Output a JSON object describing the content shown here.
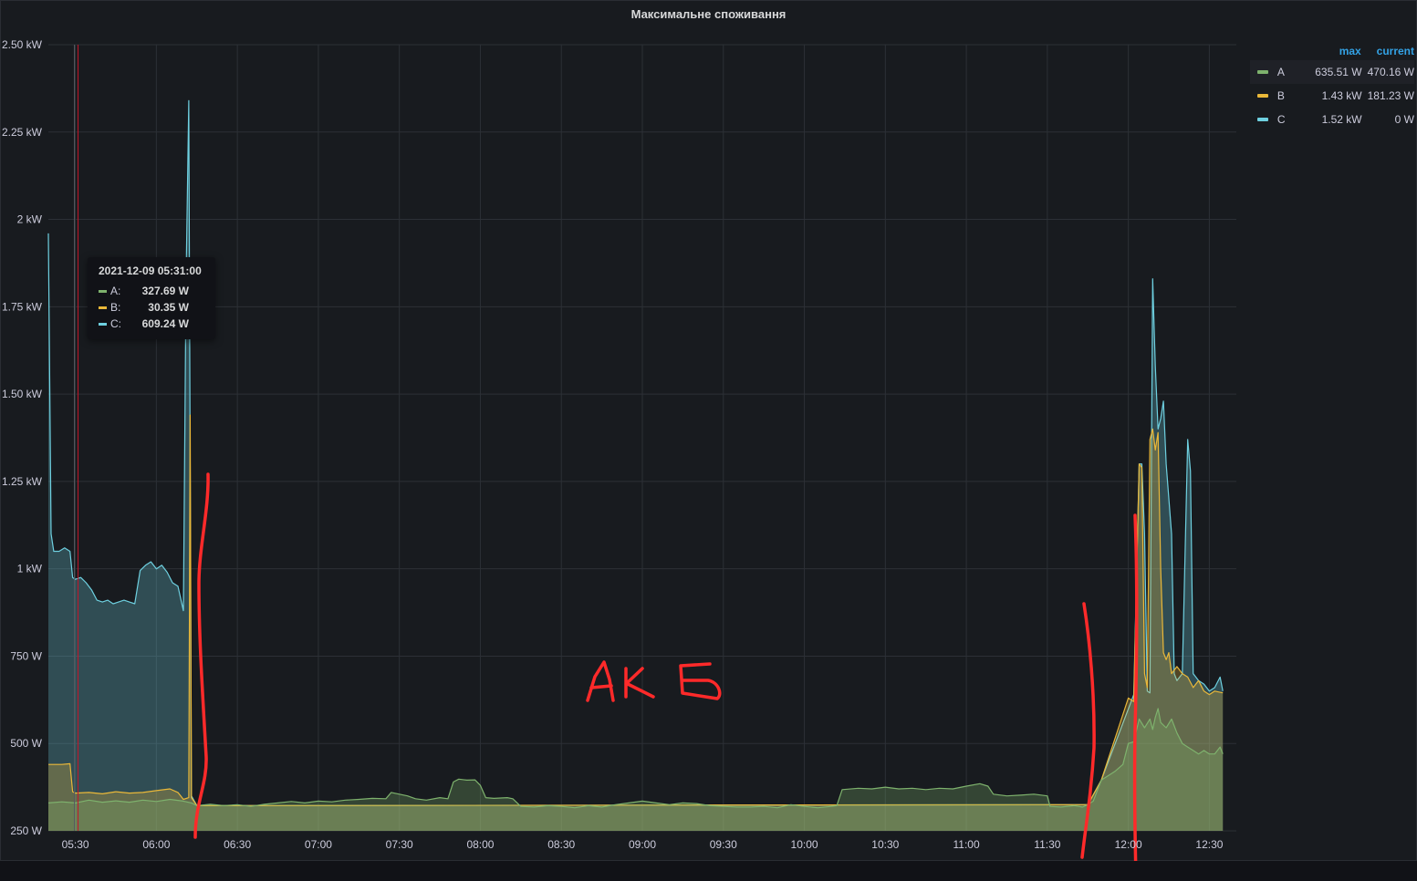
{
  "panel": {
    "title": "Максимальне споживання"
  },
  "colors": {
    "A": "#7eb26d",
    "B": "#eab839",
    "C": "#6ed0e0",
    "annotation": "#ff2a2a",
    "grid": "#2c3036",
    "text": "#ccccdc",
    "legend_header": "#33a2e5"
  },
  "legend": {
    "headers": {
      "max": "max",
      "current": "current"
    },
    "items": [
      {
        "name": "A",
        "color": "#7eb26d",
        "max": "635.51 W",
        "current": "470.16 W"
      },
      {
        "name": "B",
        "color": "#eab839",
        "max": "1.43 kW",
        "current": "181.23 W"
      },
      {
        "name": "C",
        "color": "#6ed0e0",
        "max": "1.52 kW",
        "current": "0 W"
      }
    ]
  },
  "tooltip": {
    "time": "2021-12-09 05:31:00",
    "rows": [
      {
        "name": "A:",
        "color": "#7eb26d",
        "value": "327.69 W"
      },
      {
        "name": "B:",
        "color": "#eab839",
        "value": "30.35 W"
      },
      {
        "name": "C:",
        "color": "#6ed0e0",
        "value": "609.24 W"
      }
    ]
  },
  "annotation_text": "АКБ",
  "chart_data": {
    "type": "area",
    "title": "Максимальне споживання",
    "xlabel": "",
    "ylabel": "",
    "x_range": [
      "05:20",
      "12:40"
    ],
    "ylim": [
      250,
      2500
    ],
    "y_unit": "W",
    "yticks": [
      {
        "value": 250,
        "label": "250 W"
      },
      {
        "value": 500,
        "label": "500 W"
      },
      {
        "value": 750,
        "label": "750 W"
      },
      {
        "value": 1000,
        "label": "1 kW"
      },
      {
        "value": 1250,
        "label": "1.25 kW"
      },
      {
        "value": 1500,
        "label": "1.50 kW"
      },
      {
        "value": 1750,
        "label": "1.75 kW"
      },
      {
        "value": 2000,
        "label": "2 kW"
      },
      {
        "value": 2250,
        "label": "2.25 kW"
      },
      {
        "value": 2500,
        "label": "2.50 kW"
      }
    ],
    "xticks": [
      "05:30",
      "06:00",
      "06:30",
      "07:00",
      "07:30",
      "08:00",
      "08:30",
      "09:00",
      "09:30",
      "10:00",
      "10:30",
      "11:00",
      "11:30",
      "12:00",
      "12:30"
    ],
    "grid": true,
    "legend_position": "right",
    "cursor_time": "05:31",
    "series": [
      {
        "name": "A",
        "color": "#7eb26d",
        "points": [
          [
            "05:20",
            330
          ],
          [
            "05:25",
            333
          ],
          [
            "05:30",
            330
          ],
          [
            "05:35",
            338
          ],
          [
            "05:40",
            332
          ],
          [
            "05:45",
            336
          ],
          [
            "05:50",
            332
          ],
          [
            "05:55",
            338
          ],
          [
            "06:00",
            334
          ],
          [
            "06:05",
            340
          ],
          [
            "06:10",
            335
          ],
          [
            "06:13",
            330
          ],
          [
            "06:15",
            322
          ],
          [
            "06:20",
            326
          ],
          [
            "06:25",
            322
          ],
          [
            "06:30",
            325
          ],
          [
            "06:35",
            320
          ],
          [
            "06:40",
            326
          ],
          [
            "06:45",
            330
          ],
          [
            "06:50",
            334
          ],
          [
            "06:55",
            330
          ],
          [
            "07:00",
            335
          ],
          [
            "07:05",
            333
          ],
          [
            "07:10",
            338
          ],
          [
            "07:15",
            340
          ],
          [
            "07:20",
            343
          ],
          [
            "07:25",
            342
          ],
          [
            "07:27",
            360
          ],
          [
            "07:30",
            355
          ],
          [
            "07:33",
            350
          ],
          [
            "07:36",
            342
          ],
          [
            "07:40",
            338
          ],
          [
            "07:45",
            345
          ],
          [
            "07:48",
            342
          ],
          [
            "07:50",
            390
          ],
          [
            "07:52",
            398
          ],
          [
            "07:55",
            395
          ],
          [
            "07:58",
            396
          ],
          [
            "08:00",
            380
          ],
          [
            "08:02",
            345
          ],
          [
            "08:05",
            343
          ],
          [
            "08:10",
            345
          ],
          [
            "08:12",
            342
          ],
          [
            "08:15",
            320
          ],
          [
            "08:20",
            318
          ],
          [
            "08:25",
            322
          ],
          [
            "08:30",
            320
          ],
          [
            "08:35",
            316
          ],
          [
            "08:40",
            322
          ],
          [
            "08:45",
            318
          ],
          [
            "08:50",
            325
          ],
          [
            "08:55",
            330
          ],
          [
            "09:00",
            335
          ],
          [
            "09:05",
            330
          ],
          [
            "09:10",
            325
          ],
          [
            "09:15",
            330
          ],
          [
            "09:20",
            328
          ],
          [
            "09:25",
            322
          ],
          [
            "09:30",
            320
          ],
          [
            "09:35",
            318
          ],
          [
            "09:40",
            318
          ],
          [
            "09:45",
            320
          ],
          [
            "09:50",
            316
          ],
          [
            "09:55",
            325
          ],
          [
            "10:00",
            320
          ],
          [
            "10:05",
            316
          ],
          [
            "10:10",
            320
          ],
          [
            "10:12",
            322
          ],
          [
            "10:14",
            368
          ],
          [
            "10:20",
            372
          ],
          [
            "10:25",
            370
          ],
          [
            "10:30",
            375
          ],
          [
            "10:35",
            370
          ],
          [
            "10:40",
            372
          ],
          [
            "10:45",
            368
          ],
          [
            "10:50",
            372
          ],
          [
            "10:55",
            370
          ],
          [
            "11:00",
            378
          ],
          [
            "11:05",
            385
          ],
          [
            "11:08",
            378
          ],
          [
            "11:10",
            355
          ],
          [
            "11:15",
            350
          ],
          [
            "11:20",
            352
          ],
          [
            "11:25",
            355
          ],
          [
            "11:30",
            350
          ],
          [
            "11:31",
            320
          ],
          [
            "11:35",
            318
          ],
          [
            "11:40",
            322
          ],
          [
            "11:43",
            318
          ],
          [
            "11:45",
            325
          ],
          [
            "11:47",
            335
          ],
          [
            "11:50",
            395
          ],
          [
            "11:55",
            420
          ],
          [
            "11:58",
            440
          ],
          [
            "12:00",
            500
          ],
          [
            "12:02",
            505
          ],
          [
            "12:04",
            570
          ],
          [
            "12:06",
            545
          ],
          [
            "12:08",
            570
          ],
          [
            "12:09",
            540
          ],
          [
            "12:10",
            575
          ],
          [
            "12:11",
            600
          ],
          [
            "12:12",
            560
          ],
          [
            "12:14",
            545
          ],
          [
            "12:16",
            570
          ],
          [
            "12:18",
            530
          ],
          [
            "12:20",
            500
          ],
          [
            "12:22",
            490
          ],
          [
            "12:24",
            480
          ],
          [
            "12:26",
            470
          ],
          [
            "12:28",
            480
          ],
          [
            "12:30",
            470
          ],
          [
            "12:32",
            470
          ],
          [
            "12:34",
            490
          ],
          [
            "12:35",
            470
          ]
        ]
      },
      {
        "name": "B",
        "color": "#eab839",
        "points": [
          [
            "05:20",
            440
          ],
          [
            "05:25",
            440
          ],
          [
            "05:28",
            442
          ],
          [
            "05:29",
            362
          ],
          [
            "05:30",
            358
          ],
          [
            "05:35",
            360
          ],
          [
            "05:40",
            356
          ],
          [
            "05:45",
            362
          ],
          [
            "05:50",
            358
          ],
          [
            "05:55",
            360
          ],
          [
            "06:00",
            365
          ],
          [
            "06:05",
            370
          ],
          [
            "06:08",
            360
          ],
          [
            "06:10",
            340
          ],
          [
            "06:12",
            345
          ],
          [
            "06:12.5",
            1440
          ],
          [
            "06:13",
            345
          ],
          [
            "06:15",
            322
          ],
          [
            "11:45",
            325
          ],
          [
            "11:50",
            395
          ],
          [
            "12:00",
            630
          ],
          [
            "12:02",
            620
          ],
          [
            "12:04",
            1300
          ],
          [
            "12:05",
            1290
          ],
          [
            "12:06",
            700
          ],
          [
            "12:07",
            660
          ],
          [
            "12:08",
            1370
          ],
          [
            "12:09",
            1400
          ],
          [
            "12:10",
            1340
          ],
          [
            "12:11",
            1390
          ],
          [
            "12:12",
            1000
          ],
          [
            "12:13",
            760
          ],
          [
            "12:14",
            740
          ],
          [
            "12:15",
            760
          ],
          [
            "12:16",
            700
          ],
          [
            "12:18",
            720
          ],
          [
            "12:20",
            700
          ],
          [
            "12:22",
            690
          ],
          [
            "12:24",
            660
          ],
          [
            "12:26",
            680
          ],
          [
            "12:28",
            650
          ],
          [
            "12:30",
            640
          ],
          [
            "12:32",
            650
          ],
          [
            "12:35",
            645
          ]
        ]
      },
      {
        "name": "C",
        "color": "#6ed0e0",
        "points": [
          [
            "05:20",
            1960
          ],
          [
            "05:21",
            1100
          ],
          [
            "05:22",
            1050
          ],
          [
            "05:24",
            1050
          ],
          [
            "05:26",
            1060
          ],
          [
            "05:28",
            1050
          ],
          [
            "05:29",
            975
          ],
          [
            "05:30",
            970
          ],
          [
            "05:32",
            975
          ],
          [
            "05:34",
            960
          ],
          [
            "05:36",
            940
          ],
          [
            "05:38",
            910
          ],
          [
            "05:40",
            905
          ],
          [
            "05:42",
            910
          ],
          [
            "05:44",
            900
          ],
          [
            "05:46",
            905
          ],
          [
            "05:48",
            910
          ],
          [
            "05:50",
            905
          ],
          [
            "05:52",
            900
          ],
          [
            "05:54",
            995
          ],
          [
            "05:56",
            1010
          ],
          [
            "05:58",
            1020
          ],
          [
            "06:00",
            1000
          ],
          [
            "06:02",
            1010
          ],
          [
            "06:04",
            990
          ],
          [
            "06:06",
            960
          ],
          [
            "06:08",
            950
          ],
          [
            "06:10",
            880
          ],
          [
            "06:11",
            1820
          ],
          [
            "06:12",
            2340
          ],
          [
            "06:13",
            350
          ],
          [
            "06:15",
            322
          ],
          [
            "11:45",
            325
          ],
          [
            "11:50",
            395
          ],
          [
            "12:02",
            640
          ],
          [
            "12:04",
            1300
          ],
          [
            "12:05",
            1300
          ],
          [
            "12:06",
            1100
          ],
          [
            "12:07",
            650
          ],
          [
            "12:08",
            645
          ],
          [
            "12:09",
            1830
          ],
          [
            "12:10",
            1580
          ],
          [
            "12:11",
            1400
          ],
          [
            "12:12",
            1430
          ],
          [
            "12:13",
            1480
          ],
          [
            "12:14",
            1300
          ],
          [
            "12:16",
            1100
          ],
          [
            "12:17",
            700
          ],
          [
            "12:18",
            680
          ],
          [
            "12:20",
            700
          ],
          [
            "12:22",
            1370
          ],
          [
            "12:23",
            1280
          ],
          [
            "12:24",
            700
          ],
          [
            "12:26",
            680
          ],
          [
            "12:28",
            670
          ],
          [
            "12:30",
            650
          ],
          [
            "12:32",
            660
          ],
          [
            "12:34",
            690
          ],
          [
            "12:35",
            650
          ]
        ]
      }
    ]
  }
}
